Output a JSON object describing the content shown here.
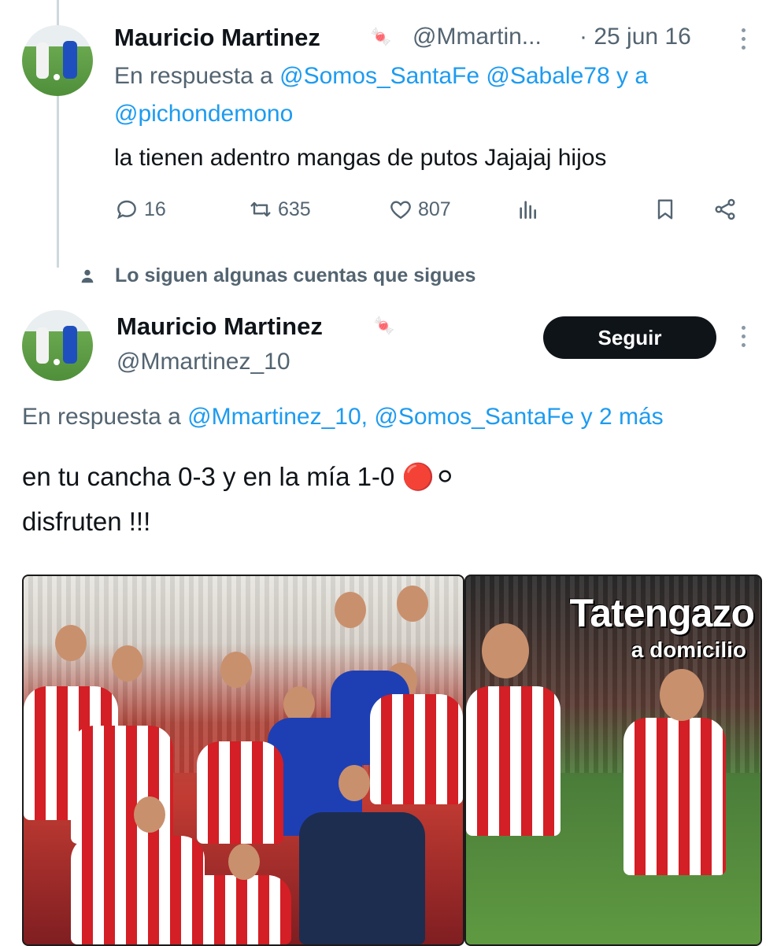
{
  "tweet1": {
    "name": "Mauricio Martinez",
    "name_emoji": "🍬",
    "handle": "@Mmartin...",
    "date": "· 25 jun 16",
    "reply_prefix": "En respuesta a",
    "reply_mention_1": "@Somos_SantaFe",
    "reply_mention_2": "@Sabale78",
    "reply_and": "y a",
    "reply_mention_3": "@pichondemono",
    "text": "la tienen adentro mangas de putos Jajajaj hijos",
    "replies": "16",
    "retweets": "635",
    "likes": "807"
  },
  "social_context": "Lo siguen algunas cuentas que sigues",
  "tweet2": {
    "name": "Mauricio Martinez",
    "name_emoji": "🍬",
    "handle": "@Mmartinez_10",
    "follow_label": "Seguir",
    "reply_prefix": "En respuesta a",
    "reply_mention_1": "@Mmartinez_10,",
    "reply_mention_2": "@Somos_SantaFe",
    "reply_more": "y 2 más",
    "text_line1": "en tu cancha 0-3 y en la mía 1-0 🔴⚪",
    "text_line2": "disfruten !!!",
    "image2_title": "Tatengazo",
    "image2_subtitle": "a domicilio"
  },
  "colors": {
    "accent": "#1d9bf0",
    "text_primary": "#0f1419",
    "text_secondary": "#536471",
    "follow_button_bg": "#0f1419"
  }
}
